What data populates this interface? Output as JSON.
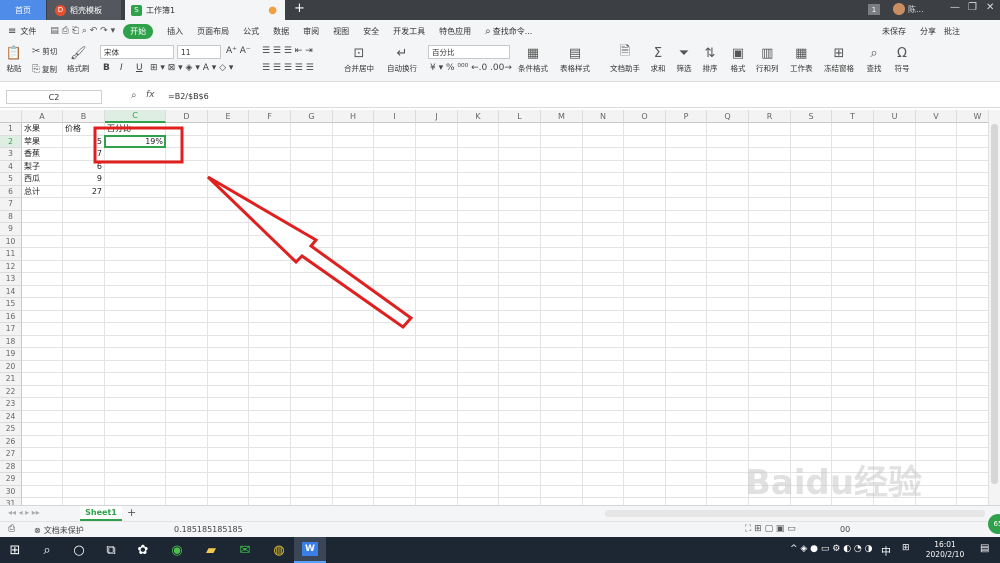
{
  "titlebar": {
    "tabs": [
      {
        "label": "首页"
      },
      {
        "label": "稻壳模板"
      },
      {
        "label": "工作簿1"
      }
    ],
    "new_tab": "+",
    "page_number": "1",
    "user_name": "陈..."
  },
  "menubar": {
    "file": "文件",
    "items": [
      "开始",
      "插入",
      "页面布局",
      "公式",
      "数据",
      "审阅",
      "视图",
      "安全",
      "开发工具",
      "特色应用"
    ],
    "search": "查找命令...",
    "right": [
      "未保存",
      "分享",
      "批注"
    ]
  },
  "ribbon": {
    "paste": "粘贴",
    "cut": "剪切",
    "copy": "复制",
    "format_painter": "格式刷",
    "font_name": "宋体",
    "font_size": "11",
    "bold": "B",
    "italic": "I",
    "underline": "U",
    "merge": "合并居中",
    "wrap": "自动换行",
    "number_format": "百分比",
    "conditional": "条件格式",
    "table_style": "表格样式",
    "doc_helper": "文档助手",
    "sum": "求和",
    "filter": "筛选",
    "sort": "排序",
    "format": "格式",
    "rows_cols": "行和列",
    "worksheet": "工作表",
    "freeze": "冻结窗格",
    "find": "查找",
    "symbol": "符号"
  },
  "formula_bar": {
    "cell_ref": "C2",
    "fx": "fx",
    "formula": "=B2/$B$6"
  },
  "grid": {
    "columns": [
      "A",
      "B",
      "C",
      "D",
      "E",
      "F",
      "G",
      "H",
      "I",
      "J",
      "K",
      "L",
      "M",
      "N",
      "O",
      "P",
      "Q",
      "R",
      "S",
      "T",
      "U",
      "V",
      "W"
    ],
    "rows": [
      "1",
      "2",
      "3",
      "4",
      "5",
      "6",
      "7",
      "8",
      "9",
      "10",
      "11",
      "12",
      "13",
      "14",
      "15",
      "16",
      "17",
      "18",
      "19",
      "20",
      "21",
      "22",
      "23",
      "24",
      "25",
      "26",
      "27",
      "28",
      "29",
      "30",
      "31"
    ],
    "cells": {
      "A1": "水果",
      "B1": "价格",
      "C1": "百分比",
      "A2": "苹果",
      "B2": "5",
      "C2": "19%",
      "A3": "香蕉",
      "B3": "7",
      "A4": "梨子",
      "B4": "6",
      "A5": "西瓜",
      "B5": "9",
      "A6": "总计",
      "B6": "27"
    }
  },
  "sheet_tabs": {
    "active": "Sheet1",
    "add": "+"
  },
  "statusbar": {
    "protect": "文档未保护",
    "value": "0.185185185185",
    "zoom_partial": "00"
  },
  "taskbar": {
    "ime": "中",
    "time": "16:01",
    "date": "2020/2/10"
  },
  "watermark": "Baidu经验",
  "colors": {
    "accent_green": "#2fa14a",
    "annotation_red": "#e0201f",
    "active_tab_blue": "#4f8be8"
  }
}
